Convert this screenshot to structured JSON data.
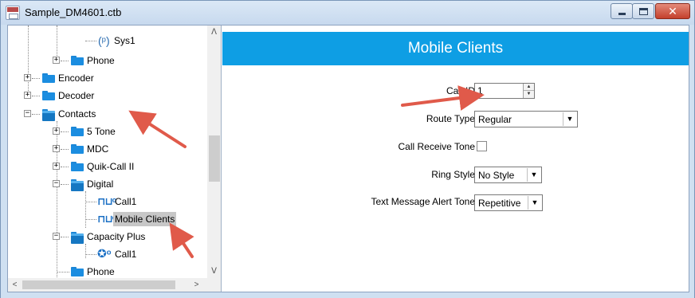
{
  "window": {
    "title": "Sample_DM4601.ctb",
    "minimize_glyph": "",
    "close_glyph": "✕"
  },
  "tree": {
    "items": [
      {
        "label": "Sys1"
      },
      {
        "label": "Phone"
      },
      {
        "label": "Encoder"
      },
      {
        "label": "Decoder"
      },
      {
        "label": "Contacts"
      },
      {
        "label": "5 Tone"
      },
      {
        "label": "MDC"
      },
      {
        "label": "Quik-Call II"
      },
      {
        "label": "Digital"
      },
      {
        "label": "Call1"
      },
      {
        "label": "Mobile Clients"
      },
      {
        "label": "Capacity Plus"
      },
      {
        "label": "Call1"
      },
      {
        "label": "Phone"
      }
    ],
    "expand_plus": "+",
    "expand_minus": "−",
    "selected": "Mobile Clients"
  },
  "form": {
    "title": "Mobile Clients",
    "call_id": {
      "label": "Call ID",
      "value": "1"
    },
    "route_type": {
      "label": "Route Type",
      "value": "Regular"
    },
    "call_receive_tone": {
      "label": "Call Receive Tone",
      "checked": false
    },
    "ring_style": {
      "label": "Ring Style",
      "value": "No Style"
    },
    "text_alert_tone": {
      "label": "Text Message Alert Tone",
      "value": "Repetitive"
    }
  },
  "colors": {
    "header": "#0e9ee4",
    "annotation_arrow": "#e05a4a",
    "folder": "#1b8de0",
    "selection": "#c7c7c7"
  },
  "icons": {
    "scroll_up": "▲",
    "scroll_down": "▼",
    "scroll_left": "◀",
    "scroll_right": "▶",
    "dropdown": "▼",
    "spin_up": "▲",
    "spin_down": "▼",
    "antenna": "📡",
    "contact": "⊓⊔",
    "group": "⚙"
  }
}
